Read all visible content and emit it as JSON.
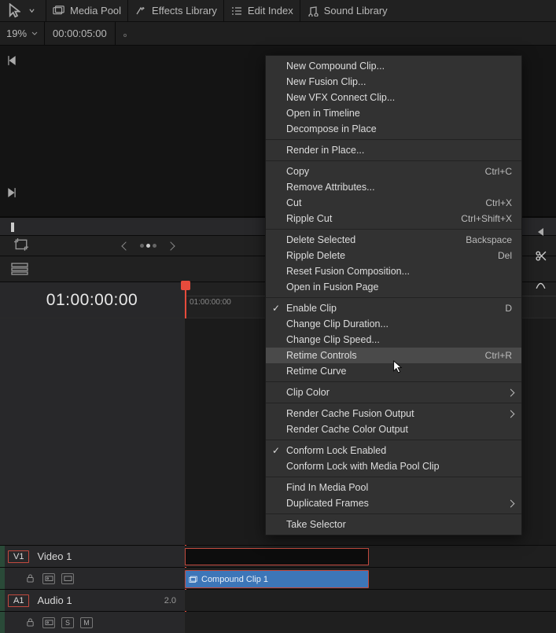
{
  "topbar": {
    "media_pool": "Media Pool",
    "effects_library": "Effects Library",
    "edit_index": "Edit Index",
    "sound_library": "Sound Library"
  },
  "zoom": {
    "percent": "19%",
    "timecode": "00:00:05:00"
  },
  "timeline": {
    "big_tc": "01:00:00:00",
    "ruler_tc": "01:00:00:00"
  },
  "tracks": {
    "video": {
      "chip": "V1",
      "name": "Video 1"
    },
    "audio": {
      "chip": "A1",
      "name": "Audio 1",
      "value": "2.0",
      "btn_s": "S",
      "btn_m": "M"
    },
    "clip_label": "Compound Clip 1"
  },
  "menu": {
    "items": [
      {
        "label": "New Compound Clip..."
      },
      {
        "label": "New Fusion Clip..."
      },
      {
        "label": "New VFX Connect Clip..."
      },
      {
        "label": "Open in Timeline"
      },
      {
        "label": "Decompose in Place"
      },
      {
        "sep": true
      },
      {
        "label": "Render in Place..."
      },
      {
        "sep": true
      },
      {
        "label": "Copy",
        "shortcut": "Ctrl+C"
      },
      {
        "label": "Remove Attributes..."
      },
      {
        "label": "Cut",
        "shortcut": "Ctrl+X"
      },
      {
        "label": "Ripple Cut",
        "shortcut": "Ctrl+Shift+X"
      },
      {
        "sep": true
      },
      {
        "label": "Delete Selected",
        "shortcut": "Backspace"
      },
      {
        "label": "Ripple Delete",
        "shortcut": "Del"
      },
      {
        "label": "Reset Fusion Composition..."
      },
      {
        "label": "Open in Fusion Page"
      },
      {
        "sep": true
      },
      {
        "label": "Enable Clip",
        "shortcut": "D",
        "check": true
      },
      {
        "label": "Change Clip Duration..."
      },
      {
        "label": "Change Clip Speed..."
      },
      {
        "label": "Retime Controls",
        "shortcut": "Ctrl+R",
        "hl": true
      },
      {
        "label": "Retime Curve"
      },
      {
        "sep": true
      },
      {
        "label": "Clip Color",
        "sub": true
      },
      {
        "sep": true
      },
      {
        "label": "Render Cache Fusion Output",
        "sub": true
      },
      {
        "label": "Render Cache Color Output"
      },
      {
        "sep": true
      },
      {
        "label": "Conform Lock Enabled",
        "check": true
      },
      {
        "label": "Conform Lock with Media Pool Clip"
      },
      {
        "sep": true
      },
      {
        "label": "Find In Media Pool"
      },
      {
        "label": "Duplicated Frames",
        "sub": true
      },
      {
        "sep": true
      },
      {
        "label": "Take Selector"
      }
    ]
  }
}
